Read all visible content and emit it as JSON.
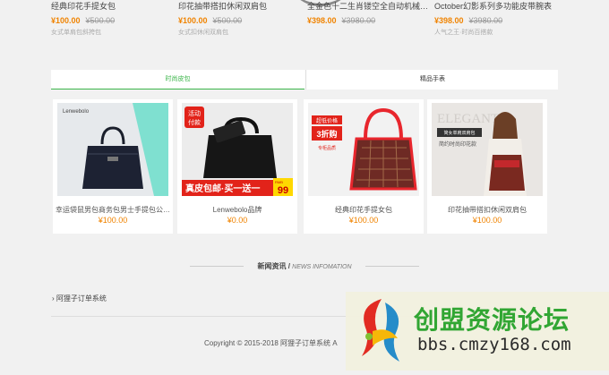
{
  "top_products": [
    {
      "name": "经典印花手提女包",
      "price": "¥100.00",
      "original": "¥500.00",
      "sub": "女式单肩包斜挎包"
    },
    {
      "name": "印花抽带搭扣休闲双肩包",
      "price": "¥100.00",
      "original": "¥500.00",
      "sub": "女式扣休闲双肩包"
    },
    {
      "name": "全金色十二生肖镂空全自动机械…",
      "price": "¥398.00",
      "original": "¥3980.00",
      "sub": ""
    },
    {
      "name": "October幻影系列多功能皮带腕表",
      "price": "¥398.00",
      "original": "¥3980.00",
      "sub": "人气之王·时尚百搭款"
    }
  ],
  "tabs": [
    {
      "label": "时尚皮包"
    },
    {
      "label": "精品手表"
    }
  ],
  "products": [
    {
      "name": "幸运袋鼠男包商务包男士手提包公…",
      "price": "¥100.00",
      "image_texts": [
        "Lenwebolo"
      ]
    },
    {
      "name": "Lenwebolo品牌",
      "price": "¥0.00",
      "image_texts": [
        "活动",
        "付款",
        "真皮包邮·买一送一",
        "RMB",
        "99"
      ]
    },
    {
      "name": "经典印花手提女包",
      "price": "¥100.00",
      "image_texts": [
        "超低价格",
        "3折购",
        "专柜品质"
      ]
    },
    {
      "name": "印花抽带搭扣休闲双肩包",
      "price": "¥100.00",
      "image_texts": [
        "ELEGANT",
        "简女单肩双肩包",
        "简约时尚印花款"
      ]
    }
  ],
  "news": {
    "title_cn": "新闻资讯",
    "separator": "/",
    "title_en": "NEWS INFOMATION",
    "items": [
      {
        "label": "阿狸子订单系统"
      }
    ]
  },
  "footer": {
    "copyright": "Copyright © 2015-2018 阿狸子订单系统 A"
  },
  "watermark": {
    "title": "创盟资源论坛",
    "url": "bbs.cmzy168.com"
  },
  "colors": {
    "accent_green": "#3bb54a",
    "price_orange": "#f08300",
    "background": "#f1f1f1"
  },
  "icons": {
    "news_bullet": "chevron-right-icon"
  }
}
